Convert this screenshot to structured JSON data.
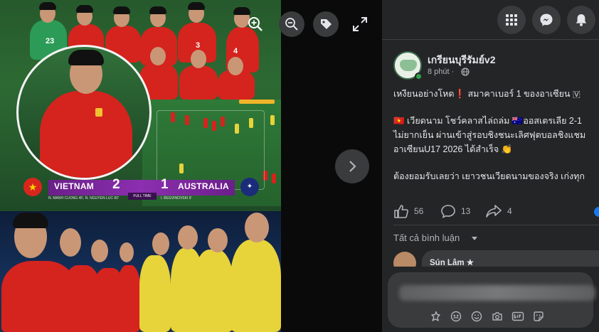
{
  "photo": {
    "team_home": "VIETNAM",
    "team_away": "AUSTRALIA",
    "score_home": "2",
    "score_away": "1",
    "status": "FULL TIME",
    "home_scorers": "N. MANH CUONG 45', N. NGUYEN LUC 60'",
    "away_scorers": "I. BEGVINOVSKI 9'",
    "jersey_numbers": [
      "23",
      "3",
      "4"
    ]
  },
  "viewer_controls": {
    "zoom_out": "zoom-out-icon",
    "tag": "tag-icon",
    "fullscreen": "fullscreen-icon",
    "next": "chevron-right-icon"
  },
  "topbar": {
    "menu_icon": "grid-menu-icon",
    "messenger_icon": "messenger-icon",
    "notifications_icon": "bell-icon"
  },
  "post": {
    "page_name": "เกรียนบุรีรัมย์v2",
    "time": "8 phút ·",
    "lines": [
      "เหงียนอย่างโหด❗ สมาคาเบอร์ 1 ของอาเซียน 🇻",
      "",
      "🇻🇳 เวียดนาม โชว์คลาสไล่ถล่ม 🇦🇺ออสเตรเลีย 2-1",
      "ไม่ยากเย็น ผ่านเข้าสู่รอบชิงชนะเลิศฟุตบอลชิงแชม",
      "อาเซียนU17 2026 ได้สำเร็จ 👏",
      "",
      "ต้องยอมรับเลยว่า เยาวชนเวียดนามของจริง เก่งทุก"
    ],
    "likes": "56",
    "comments": "13",
    "shares": "4"
  },
  "comments_section": {
    "filter_label": "Tất cả bình luận",
    "first_commenter": "Sún Lâm ★"
  },
  "colors": {
    "side_bg": "#242526",
    "button_bg": "#3a3b3c",
    "text_primary": "#e4e6eb",
    "text_secondary": "#b0b3b8",
    "online": "#31a24c",
    "scoreboard": "#8c2fb0"
  }
}
